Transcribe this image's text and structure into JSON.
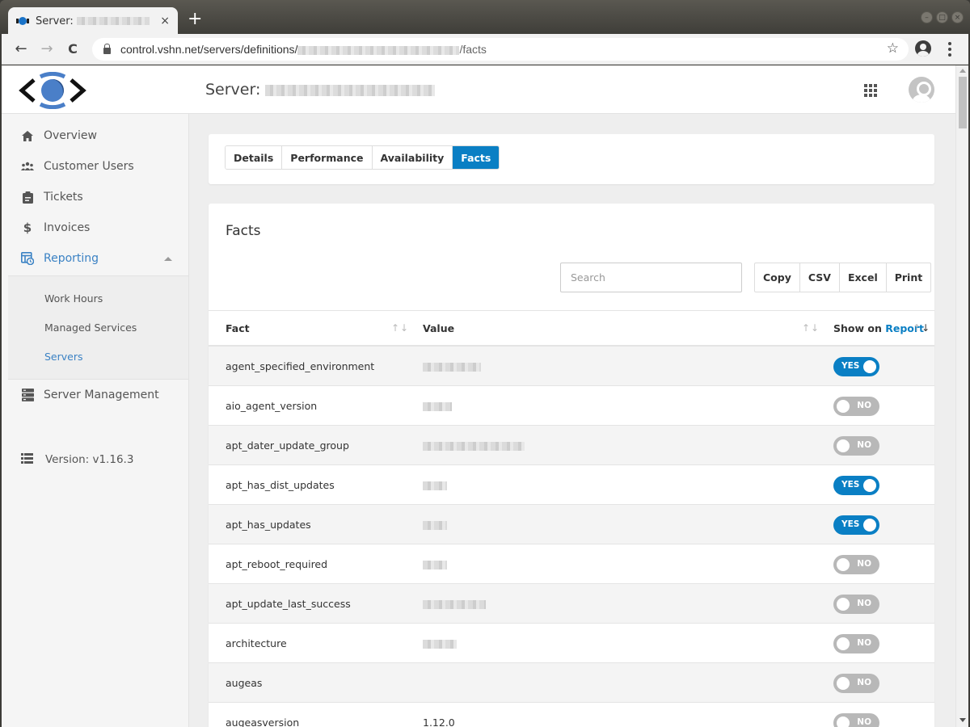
{
  "browser": {
    "tab_title": "Server:",
    "new_tab_label": "+",
    "url_host": "control.vshn.net/servers/definitions/",
    "url_suffix": "/facts",
    "back_icon": "←",
    "forward_icon": "→",
    "reload_icon": "C",
    "star_icon": "☆",
    "close_tab_icon": "×"
  },
  "header": {
    "title": "Server:"
  },
  "sidebar": {
    "items": [
      {
        "label": "Overview",
        "icon": "home-icon"
      },
      {
        "label": "Customer Users",
        "icon": "users-icon"
      },
      {
        "label": "Tickets",
        "icon": "clipboard-icon"
      },
      {
        "label": "Invoices",
        "icon": "dollar-icon"
      },
      {
        "label": "Reporting",
        "icon": "report-icon",
        "active": true,
        "expanded": true
      },
      {
        "label": "Server Management",
        "icon": "server-icon"
      }
    ],
    "reporting_subitems": [
      {
        "label": "Work Hours"
      },
      {
        "label": "Managed Services"
      },
      {
        "label": "Servers",
        "active": true
      }
    ],
    "version": "Version: v1.16.3"
  },
  "tabs": [
    {
      "label": "Details"
    },
    {
      "label": "Performance"
    },
    {
      "label": "Availability"
    },
    {
      "label": "Facts",
      "active": true
    }
  ],
  "facts": {
    "title": "Facts",
    "search_placeholder": "Search",
    "search_value": "",
    "export_buttons": [
      "Copy",
      "CSV",
      "Excel",
      "Print"
    ],
    "columns": {
      "fact": "Fact",
      "value": "Value",
      "show_on": "Show on ",
      "report": "Report"
    },
    "sort_arrows": "↑↓",
    "rows": [
      {
        "fact": "agent_specified_environment",
        "value": "",
        "redacted": true,
        "show": true,
        "toggle": "YES"
      },
      {
        "fact": "aio_agent_version",
        "value": "",
        "redacted": true,
        "show": false,
        "toggle": "NO"
      },
      {
        "fact": "apt_dater_update_group",
        "value": "",
        "redacted": true,
        "show": false,
        "toggle": "NO"
      },
      {
        "fact": "apt_has_dist_updates",
        "value": "",
        "redacted": true,
        "show": true,
        "toggle": "YES"
      },
      {
        "fact": "apt_has_updates",
        "value": "",
        "redacted": true,
        "show": true,
        "toggle": "YES"
      },
      {
        "fact": "apt_reboot_required",
        "value": "",
        "redacted": true,
        "show": false,
        "toggle": "NO"
      },
      {
        "fact": "apt_update_last_success",
        "value": "",
        "redacted": true,
        "show": false,
        "toggle": "NO"
      },
      {
        "fact": "architecture",
        "value": "",
        "redacted": true,
        "show": false,
        "toggle": "NO"
      },
      {
        "fact": "augeas",
        "value": "",
        "redacted": false,
        "show": false,
        "toggle": "NO"
      },
      {
        "fact": "augeasversion",
        "value": "1.12.0",
        "redacted": false,
        "show": false,
        "toggle": "NO"
      }
    ]
  },
  "colors": {
    "accent": "#0a7fc4",
    "sidebar_active": "#3b82c4",
    "toggle_off": "#b8b8b8"
  }
}
